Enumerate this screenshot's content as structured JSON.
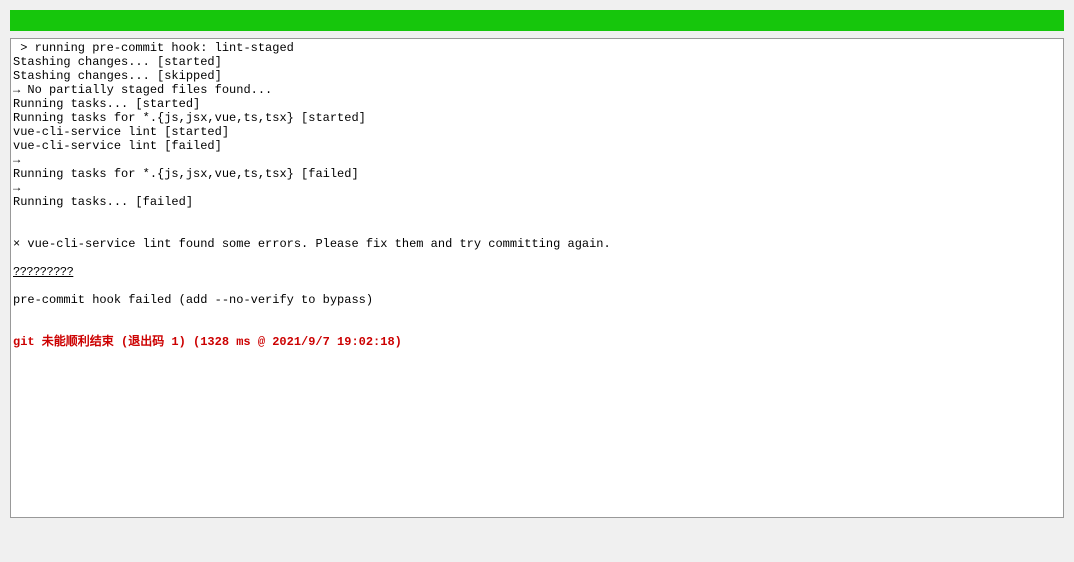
{
  "console": {
    "lines": [
      " > running pre-commit hook: lint-staged",
      "Stashing changes... [started]",
      "Stashing changes... [skipped]",
      "→ No partially staged files found...",
      "Running tasks... [started]",
      "Running tasks for *.{js,jsx,vue,ts,tsx} [started]",
      "vue-cli-service lint [started]",
      "vue-cli-service lint [failed]",
      "→",
      "Running tasks for *.{js,jsx,vue,ts,tsx} [failed]",
      "→",
      "Running tasks... [failed]",
      "",
      "",
      "× vue-cli-service lint found some errors. Please fix them and try committing again.",
      ""
    ],
    "underline_block": "?????????",
    "after_lines": [
      "",
      "pre-commit hook failed (add --no-verify to bypass)",
      "",
      ""
    ],
    "error_line": "git 未能顺利结束 (退出码 1) (1328 ms @ 2021/9/7 19:02:18)"
  }
}
